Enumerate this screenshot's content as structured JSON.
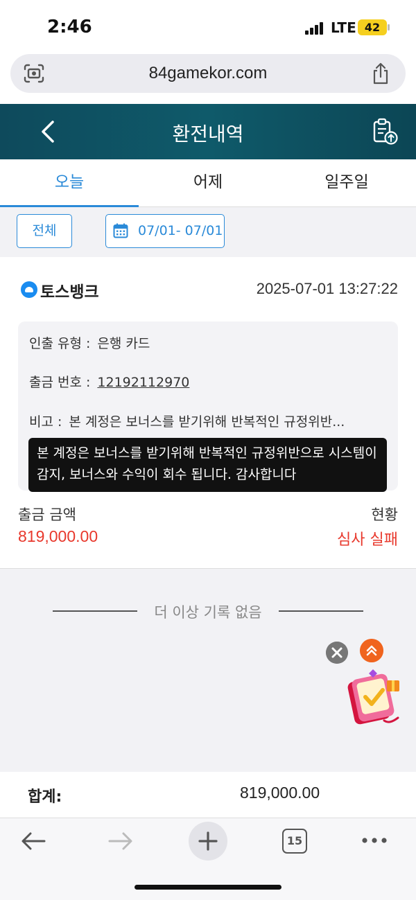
{
  "status_bar": {
    "time": "2:46",
    "network": "LTE",
    "battery": "42"
  },
  "browser": {
    "url": "84gamekor.com",
    "tab_count": "15"
  },
  "header": {
    "title": "환전내역"
  },
  "tabs": [
    {
      "label": "오늘",
      "active": true
    },
    {
      "label": "어제",
      "active": false
    },
    {
      "label": "일주일",
      "active": false
    }
  ],
  "filters": {
    "all_label": "전체",
    "date_range": "07/01- 07/01"
  },
  "record": {
    "bank": "토스뱅크",
    "datetime": "2025-07-01 13:27:22",
    "type_label": "인출 유형 :",
    "type_value": "은행 카드",
    "number_label": "출금 번호 :",
    "number_value": "12192112970",
    "note_label": "비고 :",
    "note_value": "본 계정은 보너스를 받기위해 반복적인 규정위반...",
    "tooltip": "본 계정은 보너스를 받기위해 반복적인 규정위반으로 시스템이 감지, 보너스와 수익이 회수 됩니다. 감사합니다",
    "amount_label": "출금 금액",
    "amount_value": "819,000.00",
    "status_label": "현황",
    "status_value": "심사 실패"
  },
  "no_more_text": "더 이상 기록 없음",
  "total": {
    "label": "합계:",
    "value": "819,000.00"
  },
  "colors": {
    "accent": "#2a8ad8",
    "header_bg": "#0e4a5c",
    "error": "#e8382c",
    "float_orange": "#f0641e"
  }
}
